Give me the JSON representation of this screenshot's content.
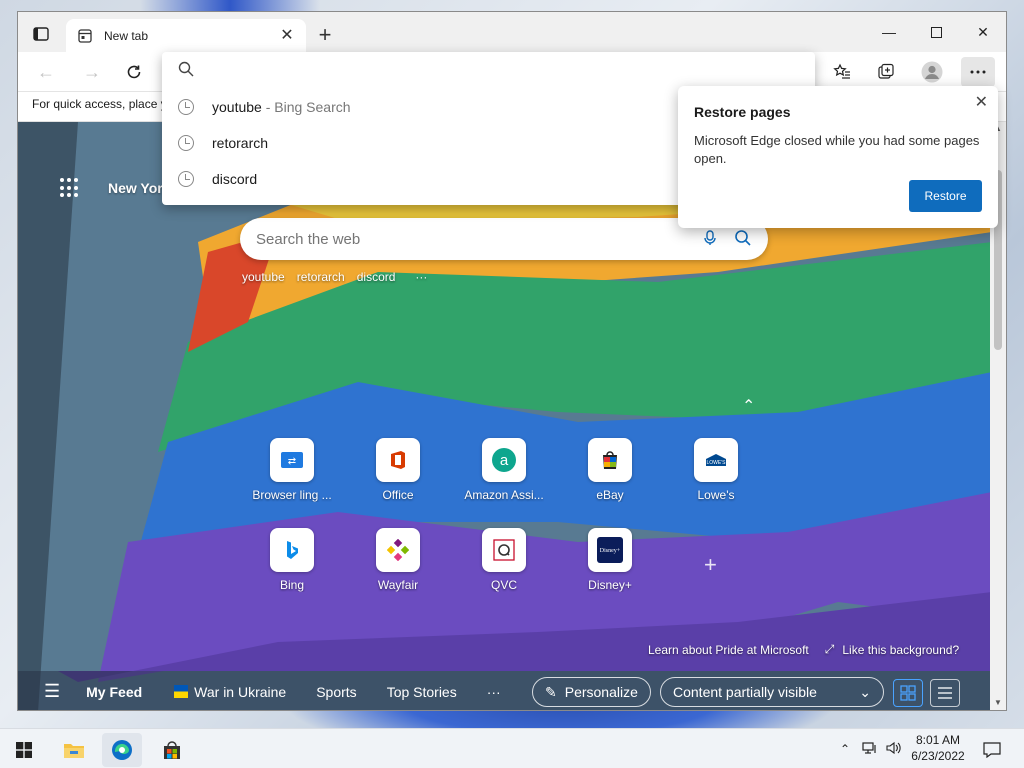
{
  "browser": {
    "tab_title": "New tab",
    "favorites_bar_text": "For quick access, place y",
    "address_placeholder": ""
  },
  "suggestions": [
    {
      "text": "youtube",
      "sub": "- Bing Search"
    },
    {
      "text": "retorarch",
      "sub": ""
    },
    {
      "text": "discord",
      "sub": ""
    }
  ],
  "popup": {
    "title": "Restore pages",
    "body": "Microsoft Edge closed while you had some pages open.",
    "button": "Restore"
  },
  "newtab": {
    "weather_label": "New York",
    "search_placeholder": "Search the web",
    "quicklinks": [
      "youtube",
      "retorarch",
      "discord"
    ],
    "quicklinks_more": "···",
    "tiles": [
      {
        "label": "Browser ling ...",
        "icon": "link-icon",
        "color": "#1f7ae0"
      },
      {
        "label": "Office",
        "icon": "office-icon",
        "color": "#d83b01"
      },
      {
        "label": "Amazon Assi...",
        "icon": "amazon-icon",
        "color": "#0ea68e"
      },
      {
        "label": "eBay",
        "icon": "ebay-icon",
        "color": "#e53238"
      },
      {
        "label": "Lowe's",
        "icon": "lowes-icon",
        "color": "#004990"
      },
      {
        "label": "Bing",
        "icon": "bing-icon",
        "color": "#0c8ce9"
      },
      {
        "label": "Wayfair",
        "icon": "wayfair-icon",
        "color": "#7f187f"
      },
      {
        "label": "QVC",
        "icon": "qvc-icon",
        "color": "#c8102e"
      },
      {
        "label": "Disney+",
        "icon": "disney-icon",
        "color": "#0b1d5a"
      }
    ],
    "credit_left": "Learn about Pride at Microsoft",
    "credit_right": "Like this background?"
  },
  "feed": {
    "my_feed": "My Feed",
    "items": [
      "War in Ukraine",
      "Sports",
      "Top Stories"
    ],
    "more": "···",
    "personalize": "Personalize",
    "content_visibility": "Content partially visible"
  },
  "taskbar": {
    "time": "8:01 AM",
    "date": "6/23/2022"
  }
}
